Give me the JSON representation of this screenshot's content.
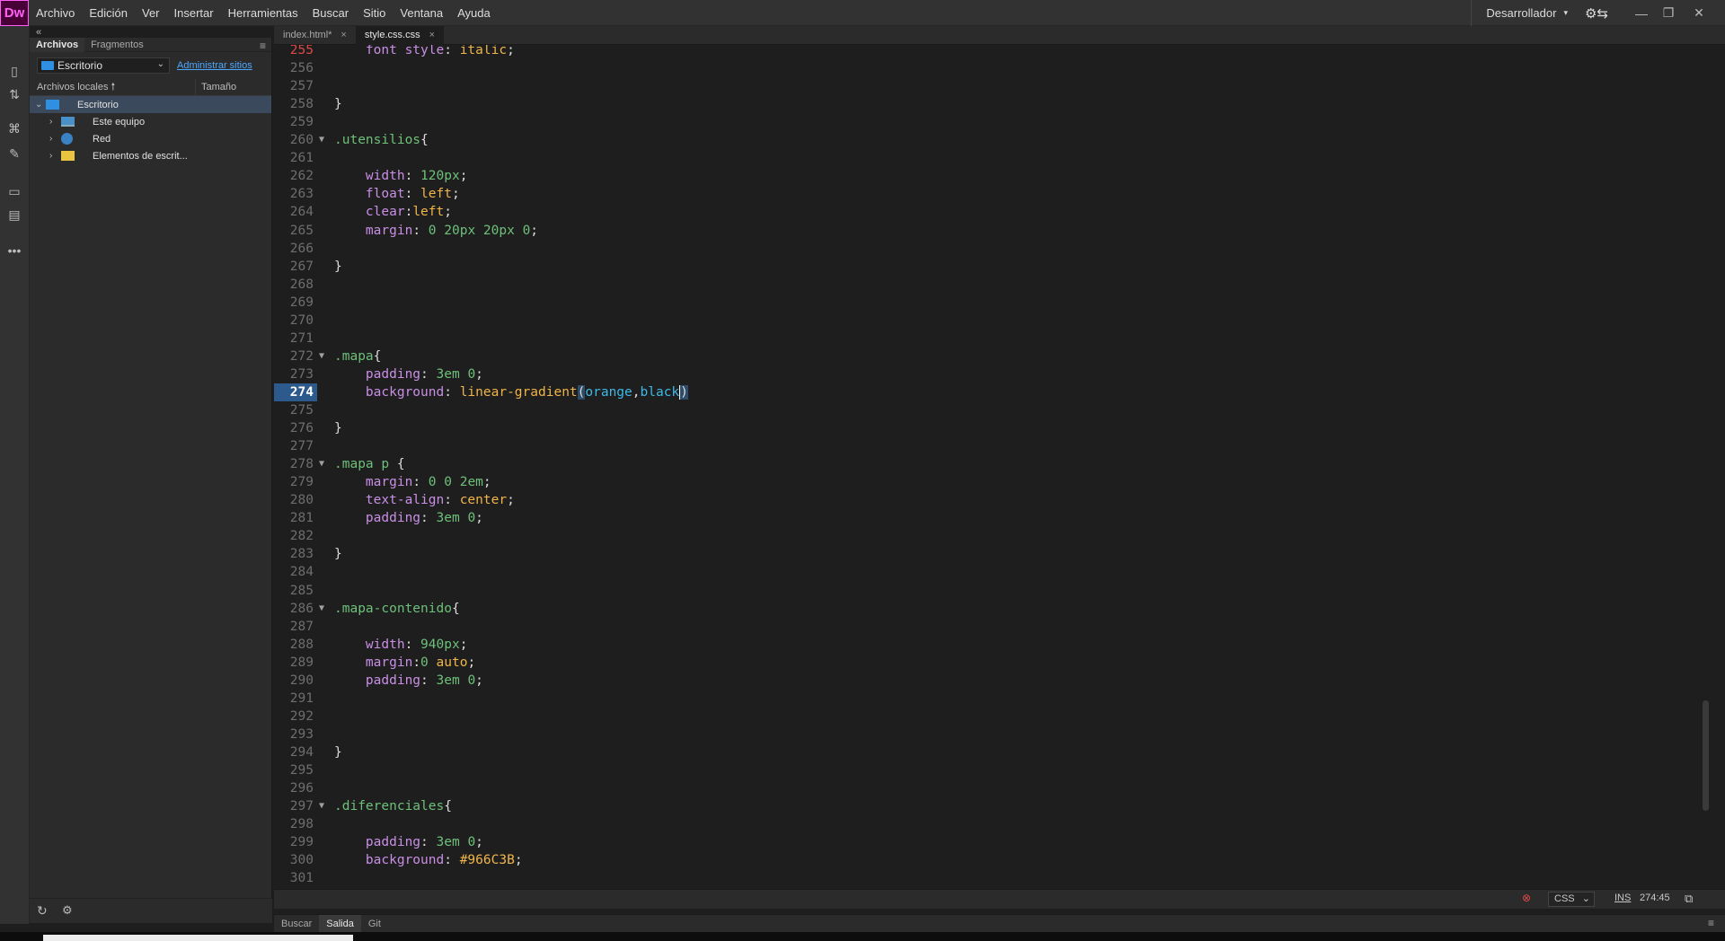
{
  "app": {
    "logo": "Dw",
    "menu": [
      "Archivo",
      "Edición",
      "Ver",
      "Insertar",
      "Herramientas",
      "Buscar",
      "Sitio",
      "Ventana",
      "Ayuda"
    ],
    "workspace": "Desarrollador"
  },
  "files_panel": {
    "tabs": [
      "Archivos",
      "Fragmentos"
    ],
    "site_selector": "Escritorio",
    "manage_link": "Administrar sitios",
    "columns": [
      "Archivos locales",
      "Tamaño"
    ],
    "tree": [
      {
        "label": "Escritorio",
        "icon": "desktop-icon"
      },
      {
        "label": "Este equipo",
        "icon": "computer-icon"
      },
      {
        "label": "Red",
        "icon": "network-icon"
      },
      {
        "label": "Elementos de escrit...",
        "icon": "folder-icon"
      }
    ]
  },
  "editor": {
    "tabs": [
      {
        "label": "index.html*",
        "close": "×"
      },
      {
        "label": "style.css.css",
        "close": "×"
      }
    ],
    "lines": [
      {
        "n": "255",
        "t": "    font style: italic;"
      },
      {
        "n": "256",
        "t": ""
      },
      {
        "n": "257",
        "t": ""
      },
      {
        "n": "258",
        "t": "}"
      },
      {
        "n": "259",
        "t": ""
      },
      {
        "n": "260",
        "t": ".utensilios{"
      },
      {
        "n": "261",
        "t": ""
      },
      {
        "n": "262",
        "t": "    width: 120px;"
      },
      {
        "n": "263",
        "t": "    float: left;"
      },
      {
        "n": "264",
        "t": "    clear:left;"
      },
      {
        "n": "265",
        "t": "    margin: 0 20px 20px 0;"
      },
      {
        "n": "266",
        "t": ""
      },
      {
        "n": "267",
        "t": "}"
      },
      {
        "n": "268",
        "t": ""
      },
      {
        "n": "269",
        "t": ""
      },
      {
        "n": "270",
        "t": ""
      },
      {
        "n": "271",
        "t": ""
      },
      {
        "n": "272",
        "t": ".mapa{"
      },
      {
        "n": "273",
        "t": "    padding: 3em 0;"
      },
      {
        "n": "274",
        "t": "    background: linear-gradient(orange,black)"
      },
      {
        "n": "275",
        "t": ""
      },
      {
        "n": "276",
        "t": "}"
      },
      {
        "n": "277",
        "t": ""
      },
      {
        "n": "278",
        "t": ".mapa p {"
      },
      {
        "n": "279",
        "t": "    margin: 0 0 2em;"
      },
      {
        "n": "280",
        "t": "    text-align: center;"
      },
      {
        "n": "281",
        "t": "    padding: 3em 0;"
      },
      {
        "n": "282",
        "t": ""
      },
      {
        "n": "283",
        "t": "}"
      },
      {
        "n": "284",
        "t": ""
      },
      {
        "n": "285",
        "t": ""
      },
      {
        "n": "286",
        "t": ".mapa-contenido{"
      },
      {
        "n": "287",
        "t": ""
      },
      {
        "n": "288",
        "t": "    width: 940px;"
      },
      {
        "n": "289",
        "t": "    margin:0 auto;"
      },
      {
        "n": "290",
        "t": "    padding: 3em 0;"
      },
      {
        "n": "291",
        "t": ""
      },
      {
        "n": "292",
        "t": ""
      },
      {
        "n": "293",
        "t": ""
      },
      {
        "n": "294",
        "t": "}"
      },
      {
        "n": "295",
        "t": ""
      },
      {
        "n": "296",
        "t": ""
      },
      {
        "n": "297",
        "t": ".diferenciales{"
      },
      {
        "n": "298",
        "t": ""
      },
      {
        "n": "299",
        "t": "    padding: 3em 0;"
      },
      {
        "n": "300",
        "t": "    background: #966C3B;"
      },
      {
        "n": "301",
        "t": ""
      }
    ],
    "current_line": "274",
    "error_line": "255",
    "folded_lines": [
      "260",
      "272",
      "278",
      "286",
      "297"
    ]
  },
  "status": {
    "language": "CSS",
    "mode": "INS",
    "position": "274:45"
  },
  "bottom_tabs": [
    "Buscar",
    "Salida",
    "Git"
  ],
  "colors": {
    "selector": "#6ec07a",
    "property": "#c98fe6",
    "value_keyword": "#f0b54a",
    "function_arg": "#3fb9e8",
    "current_line_gutter": "#2c5a8c",
    "error_line_number": "#e04848",
    "brand": "#470137"
  }
}
